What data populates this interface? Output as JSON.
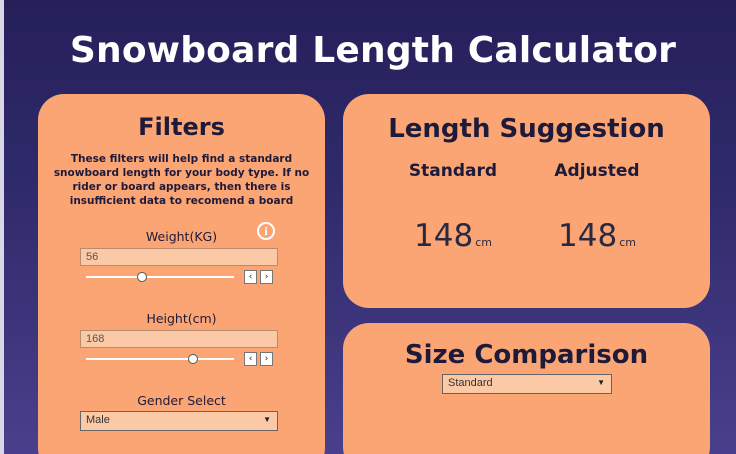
{
  "page": {
    "title": "Snowboard Length Calculator"
  },
  "filters": {
    "title": "Filters",
    "description": "These filters will help find a standard snowboard length for your body type. If no rider or board appears, then there is insufficient data to recomend a board",
    "weight": {
      "label": "Weight(KG)",
      "value": "56",
      "slider_fraction": 0.38
    },
    "height": {
      "label": "Height(cm)",
      "value": "168",
      "slider_fraction": 0.72
    },
    "gender": {
      "label": "Gender Select",
      "selected": "Male"
    },
    "icons": {
      "info": "info-icon"
    },
    "stepper": {
      "prev": "‹",
      "next": "›"
    }
  },
  "suggestion": {
    "title": "Length Suggestion",
    "standard": {
      "label": "Standard",
      "value": "148",
      "unit": "cm"
    },
    "adjusted": {
      "label": "Adjusted",
      "value": "148",
      "unit": "cm"
    }
  },
  "comparison": {
    "title": "Size Comparison",
    "selected": "Standard"
  },
  "colors": {
    "card": "#fba574",
    "background": "#2f2a6a",
    "input": "#fcc9a6"
  }
}
